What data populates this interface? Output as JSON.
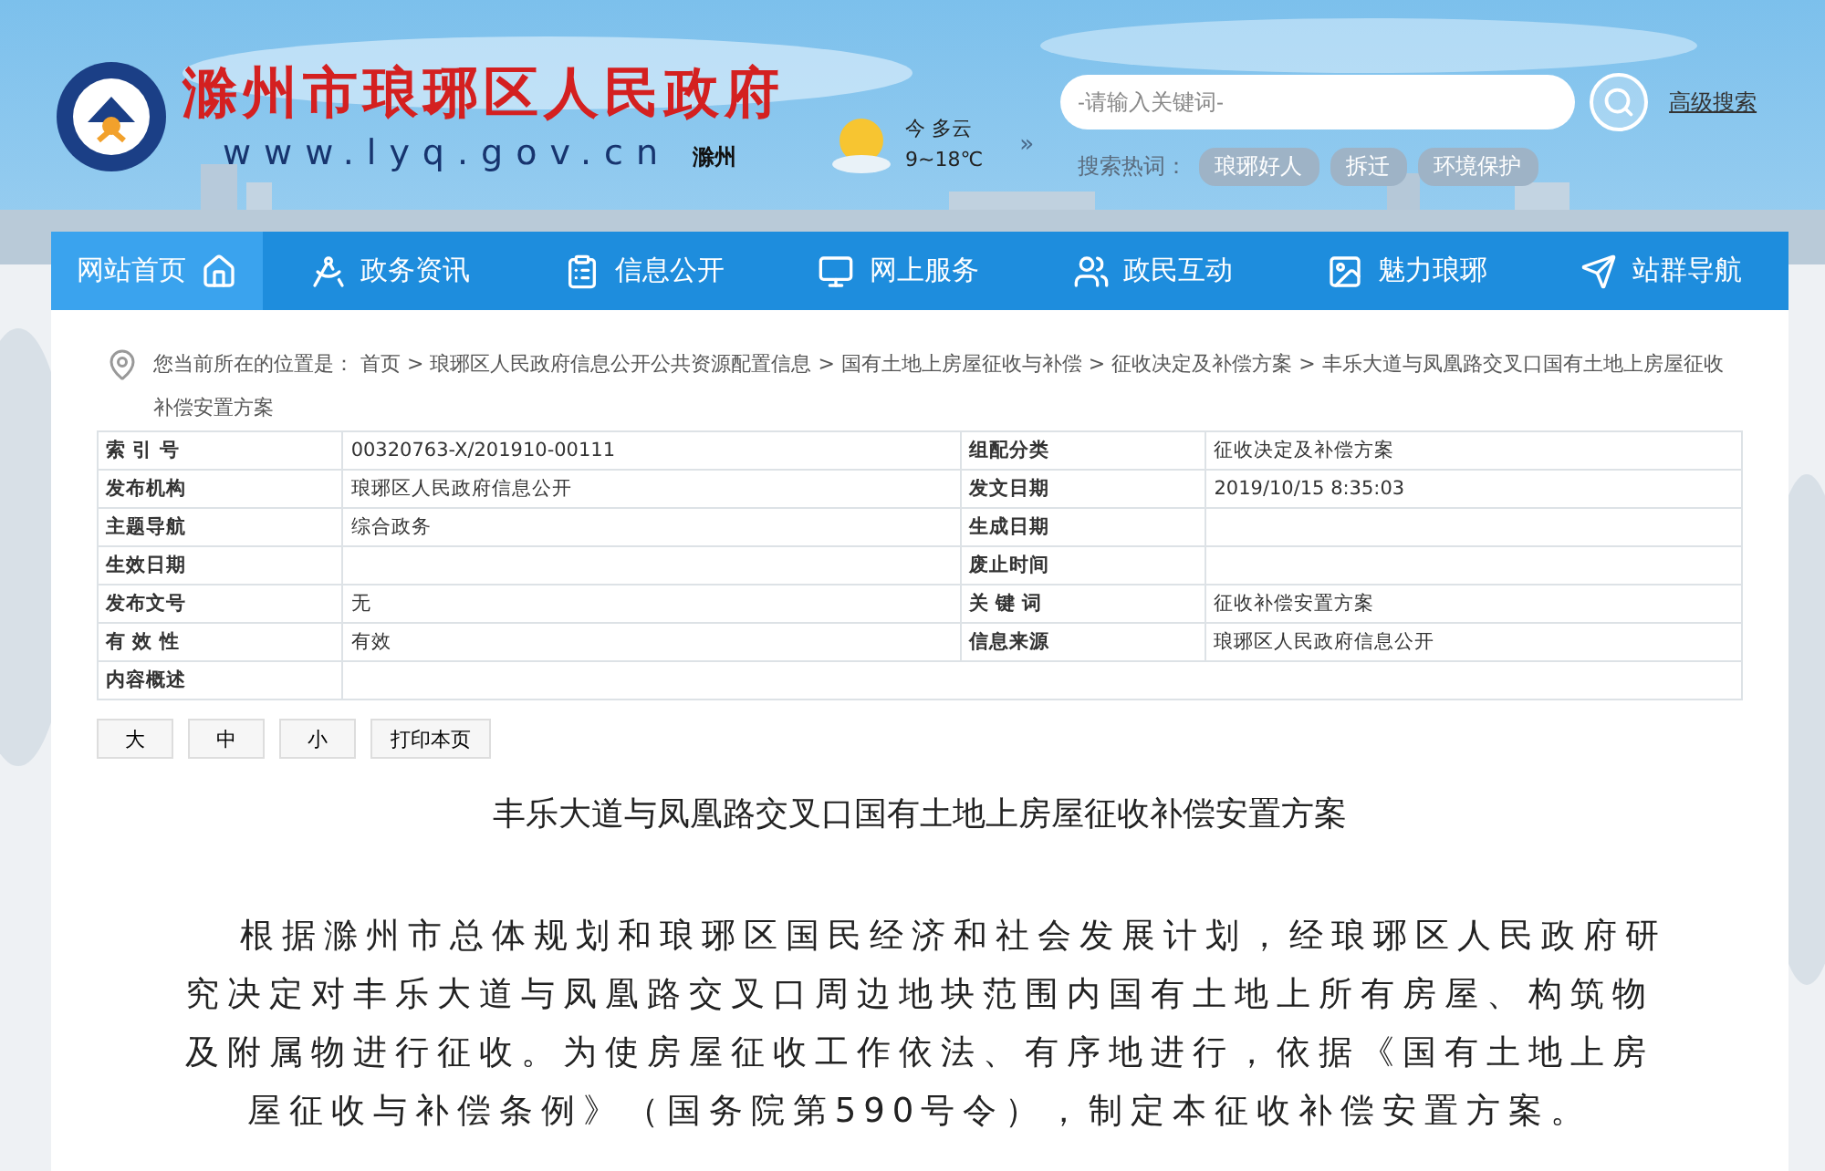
{
  "site": {
    "title": "滁州市琅琊区人民政府",
    "url": "www.lyq.gov.cn",
    "city": "滁州"
  },
  "weather": {
    "day": "今",
    "condition": "多云",
    "range": "9~18℃",
    "more": "»"
  },
  "search": {
    "placeholder": "-请输入关键词-",
    "advanced": "高级搜索",
    "hot_label": "搜索热词：",
    "hot_words": [
      "琅琊好人",
      "拆迁",
      "环境保护"
    ]
  },
  "nav": [
    {
      "label": "网站首页",
      "selected": true
    },
    {
      "label": "政务资讯",
      "selected": false
    },
    {
      "label": "信息公开",
      "selected": false
    },
    {
      "label": "网上服务",
      "selected": false
    },
    {
      "label": "政民互动",
      "selected": false
    },
    {
      "label": "魅力琅琊",
      "selected": false
    },
    {
      "label": "站群导航",
      "selected": false
    }
  ],
  "breadcrumb": "您当前所在的位置是： 首页 > 琅琊区人民政府信息公开公共资源配置信息 > 国有土地上房屋征收与补偿 > 征收决定及补偿方案 > 丰乐大道与凤凰路交叉口国有土地上房屋征收补偿安置方案",
  "meta_rows": [
    [
      {
        "label": "索 引 号",
        "value": "00320763-X/201910-00111"
      },
      {
        "label": "组配分类",
        "value": "征收决定及补偿方案"
      }
    ],
    [
      {
        "label": "发布机构",
        "value": "琅琊区人民政府信息公开"
      },
      {
        "label": "发文日期",
        "value": "2019/10/15 8:35:03"
      }
    ],
    [
      {
        "label": "主题导航",
        "value": "综合政务"
      },
      {
        "label": "生成日期"
      }
    ],
    [
      {
        "label": "生效日期"
      },
      {
        "label": "废止时间"
      }
    ],
    [
      {
        "label": "发布文号",
        "value": "无"
      },
      {
        "label": "关 键 词",
        "value": "征收补偿安置方案"
      }
    ],
    [
      {
        "label": "有 效 性",
        "value": "有效"
      },
      {
        "label": "信息来源",
        "value": "琅琊区人民政府信息公开"
      }
    ],
    [
      {
        "label": "内容概述"
      }
    ]
  ],
  "tools": [
    "大",
    "中",
    "小",
    "打印本页"
  ],
  "article": {
    "title": "丰乐大道与凤凰路交叉口国有土地上房屋征收补偿安置方案",
    "body": "根据滁州市总体规划和琅琊区国民经济和社会发展计划，经琅琊区人民政府研究决定对丰乐大道与凤凰路交叉口周边地块范围内国有土地上所有房屋、构筑物及附属物进行征收。为使房屋征收工作依法、有序地进行，依据《国有土地上房屋征收与补偿条例》（国务院第590号令），制定本征收补偿安置方案。"
  }
}
